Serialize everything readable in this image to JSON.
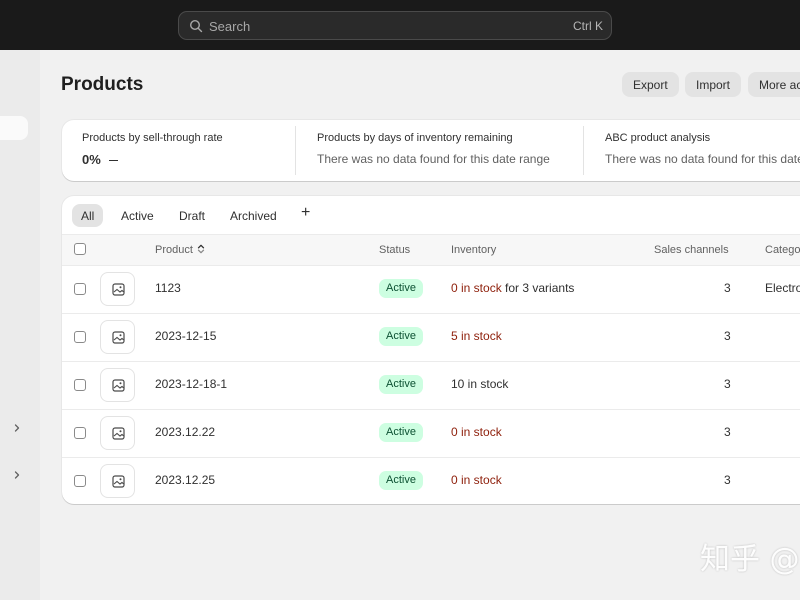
{
  "search": {
    "placeholder": "Search",
    "shortcut": "Ctrl K"
  },
  "header": {
    "title": "Products",
    "buttons": {
      "export": "Export",
      "import": "Import",
      "more": "More actions"
    }
  },
  "metrics": [
    {
      "title": "Products by sell-through rate",
      "value": "0%"
    },
    {
      "title": "Products by days of inventory remaining",
      "empty": "There was no data found for this date range"
    },
    {
      "title": "ABC product analysis",
      "empty": "There was no data found for this date range"
    }
  ],
  "tabs": {
    "all": "All",
    "active": "Active",
    "draft": "Draft",
    "archived": "Archived",
    "add": "+"
  },
  "columns": {
    "product": "Product",
    "status": "Status",
    "inventory": "Inventory",
    "sales_channels": "Sales channels",
    "category": "Category"
  },
  "rows": [
    {
      "product": "1123",
      "status": "Active",
      "inventory_count": "0 in stock",
      "inventory_suffix": " for 3 variants",
      "sales_channels": "3",
      "category": "Electronics"
    },
    {
      "product": "2023-12-15",
      "status": "Active",
      "inventory_count": "5 in stock",
      "inventory_suffix": "",
      "sales_channels": "3",
      "category": ""
    },
    {
      "product": "2023-12-18-1",
      "status": "Active",
      "inventory_count": "10 in stock",
      "inventory_suffix": "",
      "sales_channels": "3",
      "category": ""
    },
    {
      "product": "2023.12.22",
      "status": "Active",
      "inventory_count": "0 in stock",
      "inventory_suffix": "",
      "sales_channels": "3",
      "category": ""
    },
    {
      "product": "2023.12.25",
      "status": "Active",
      "inventory_count": "0 in stock",
      "inventory_suffix": "",
      "sales_channels": "3",
      "category": ""
    }
  ],
  "watermark": "知乎 @",
  "colors": {
    "topbar": "#1a1a1a",
    "badge_bg": "#cdfee1",
    "badge_text": "#0c5132",
    "low_stock": "#8e1f0b"
  }
}
